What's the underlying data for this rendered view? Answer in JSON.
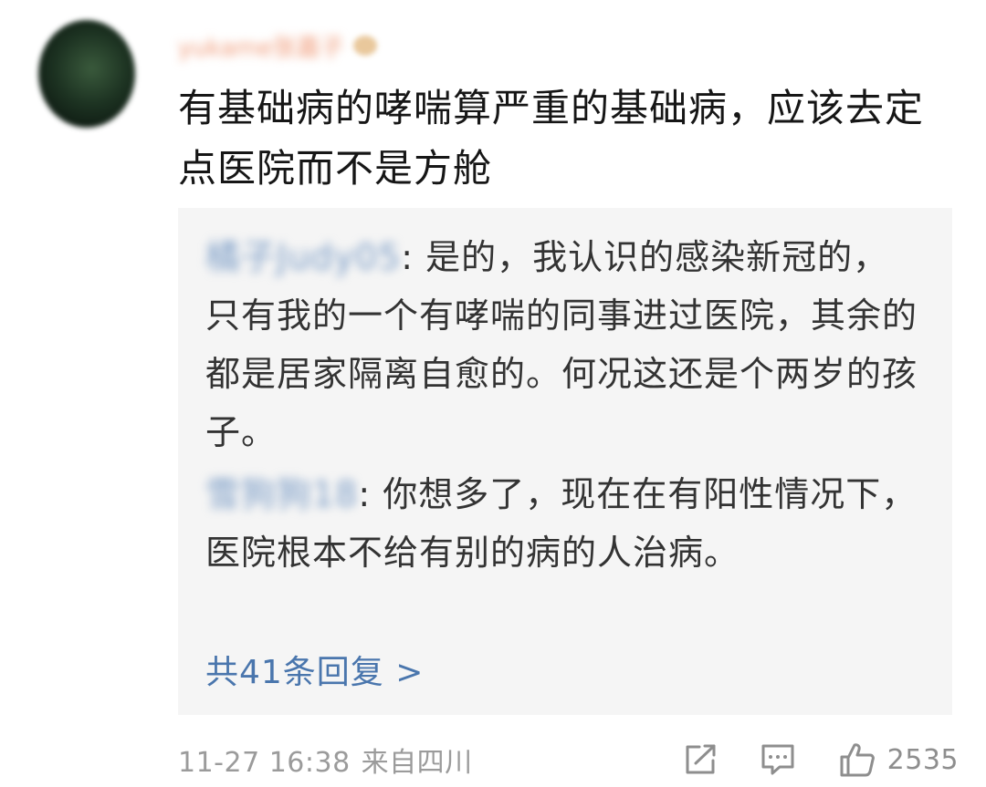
{
  "comment": {
    "username": "yukame张嘉子",
    "text": "有基础病的哮喘算严重的基础病，应该去定点医院而不是方舱"
  },
  "replies": [
    {
      "author": "橘子Judy05",
      "separator": ":",
      "text": " 是的，我认识的感染新冠的，只有我的一个有哮喘的同事进过医院，其余的都是居家隔离自愈的。何况这还是个两岁的孩子。"
    },
    {
      "author": "雪狗狗18",
      "separator": ":",
      "text": " 你想多了，现在在有阳性情况下，医院根本不给有别的病的人治病。"
    }
  ],
  "more_replies": "共41条回复 >",
  "footer": {
    "timestamp": "11-27 16:38",
    "location": "来自四川",
    "like_count": "2535"
  },
  "icons": {
    "share": "share-icon",
    "comment": "comment-icon",
    "like": "thumbs-up-icon"
  },
  "colors": {
    "link": "#4a76ad",
    "reply_bg": "#f5f5f5",
    "meta": "#9b9b9b"
  }
}
